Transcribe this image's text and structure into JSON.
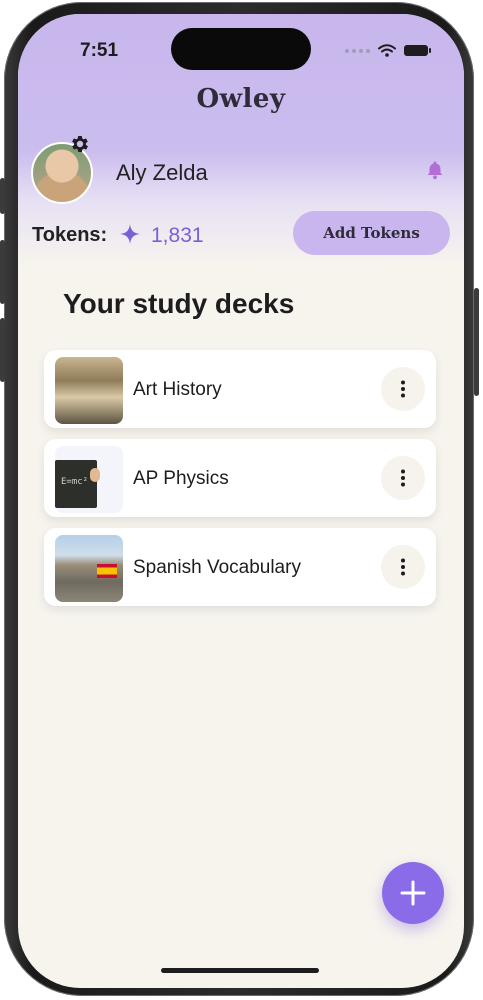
{
  "status_bar": {
    "time": "7:51"
  },
  "app": {
    "title": "Owley"
  },
  "user": {
    "name": "Aly Zelda"
  },
  "tokens": {
    "label": "Tokens:",
    "value": "1,831",
    "add_button_label": "Add Tokens"
  },
  "decks": {
    "title": "Your study decks",
    "items": [
      {
        "name": "Art History",
        "thumbnail": "art-history-image"
      },
      {
        "name": "AP Physics",
        "thumbnail": "ap-physics-image"
      },
      {
        "name": "Spanish Vocabulary",
        "thumbnail": "spanish-vocabulary-image"
      }
    ]
  },
  "colors": {
    "accent": "#8b6ce8",
    "header": "#c8b6ec",
    "background": "#f7f4ee",
    "token_text": "#7a5fd6"
  },
  "icons": [
    "gear-icon",
    "bell-icon",
    "sparkle-icon",
    "more-vertical-icon",
    "plus-icon",
    "wifi-icon",
    "battery-icon"
  ]
}
